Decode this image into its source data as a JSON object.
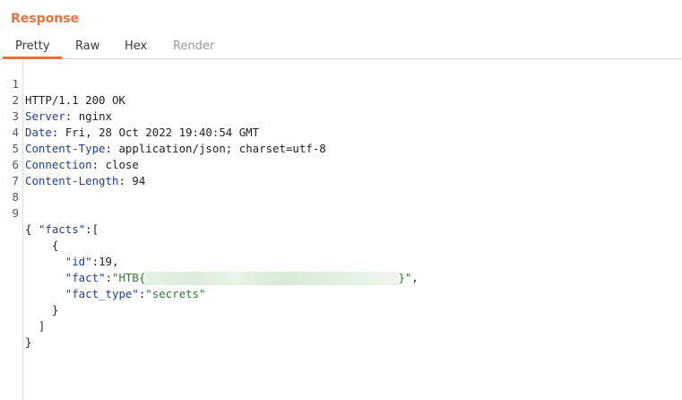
{
  "panel": {
    "title": "Response"
  },
  "tabs": [
    {
      "label": "Pretty",
      "active": true
    },
    {
      "label": "Raw",
      "active": false
    },
    {
      "label": "Hex",
      "active": false
    },
    {
      "label": "Render",
      "active": false,
      "disabled": true
    }
  ],
  "colors": {
    "accent": "#e8703a",
    "header_key": "#1f3f9a",
    "json_string": "#2f7a2f"
  },
  "response": {
    "status_line": "HTTP/1.1 200 OK",
    "headers": [
      {
        "key": "Server",
        "value": "nginx"
      },
      {
        "key": "Date",
        "value": "Fri, 28 Oct 2022 19:40:54 GMT"
      },
      {
        "key": "Content-Type",
        "value": "application/json; charset=utf-8"
      },
      {
        "key": "Connection",
        "value": "close"
      },
      {
        "key": "Content-Length",
        "value": "94"
      }
    ],
    "body": {
      "facts_key": "\"facts\"",
      "id_key": "\"id\"",
      "id_value": "19",
      "fact_key": "\"fact\"",
      "fact_prefix": "\"HTB{",
      "fact_suffix": "}\"",
      "fact_redacted": true,
      "fact_type_key": "\"fact_type\"",
      "fact_type_value": "\"secrets\""
    }
  },
  "line_numbers": [
    "1",
    "2",
    "3",
    "4",
    "5",
    "6",
    "7",
    "8",
    "9"
  ]
}
